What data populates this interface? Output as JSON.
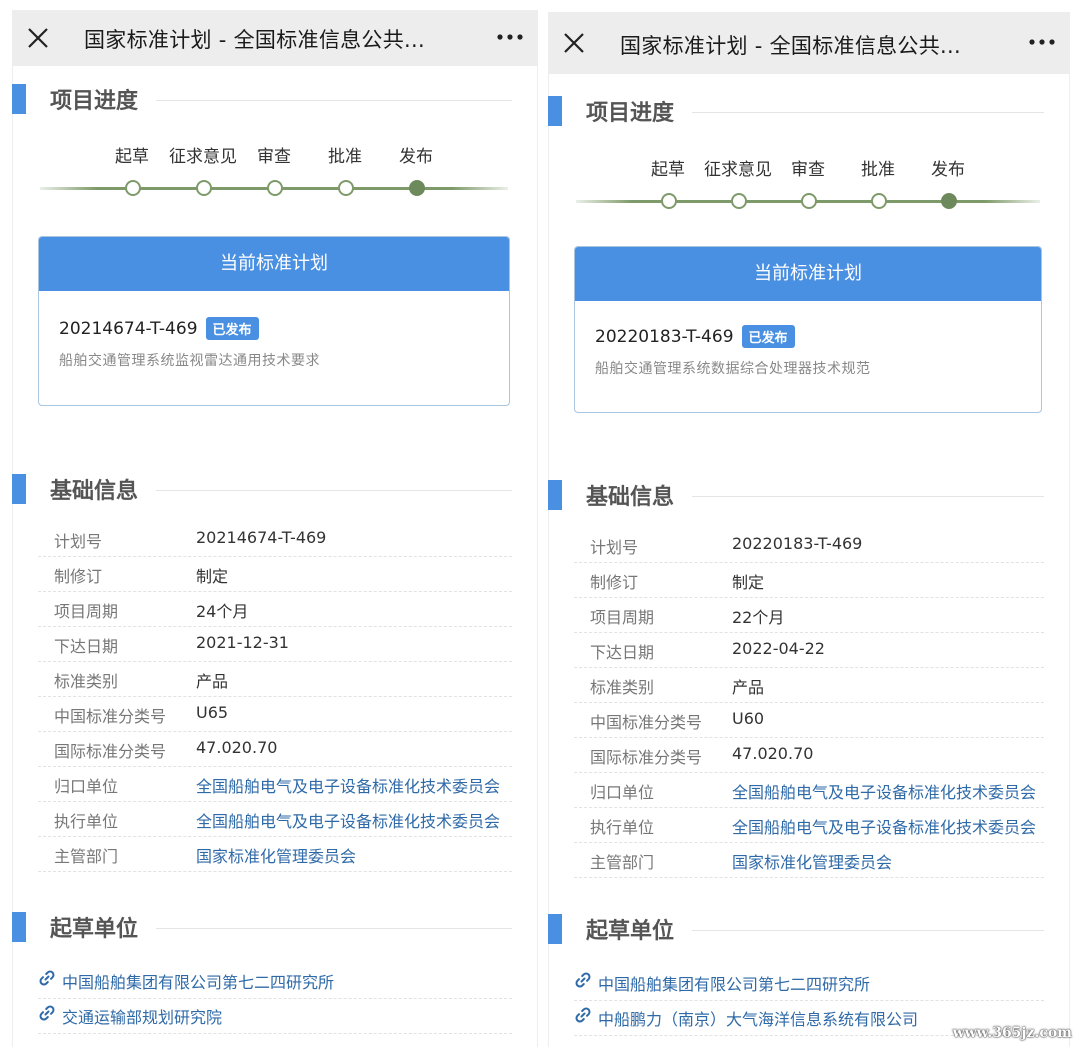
{
  "left": {
    "title": "国家标准计划 - 全国标准信息公共...",
    "sections": {
      "progress": "项目进度",
      "basic": "基础信息",
      "drafters": "起草单位"
    },
    "steps": [
      "起草",
      "征求意见",
      "审查",
      "批准",
      "发布"
    ],
    "current_step": "发布",
    "card": {
      "header": "当前标准计划",
      "number": "20214674-T-469",
      "status": "已发布",
      "name": "船舶交通管理系统监视雷达通用技术要求"
    },
    "info": [
      {
        "key": "计划号",
        "value": "20214674-T-469"
      },
      {
        "key": "制修订",
        "value": "制定"
      },
      {
        "key": "项目周期",
        "value": "24个月"
      },
      {
        "key": "下达日期",
        "value": "2021-12-31"
      },
      {
        "key": "标准类别",
        "value": "产品"
      },
      {
        "key": "中国标准分类号",
        "value": "U65"
      },
      {
        "key": "国际标准分类号",
        "value": "47.020.70"
      },
      {
        "key": "归口单位",
        "value": "全国船舶电气及电子设备标准化技术委员会"
      },
      {
        "key": "执行单位",
        "value": "全国船舶电气及电子设备标准化技术委员会"
      },
      {
        "key": "主管部门",
        "value": "国家标准化管理委员会"
      }
    ],
    "drafters": [
      "中国船舶集团有限公司第七二四研究所",
      "交通运输部规划研究院"
    ]
  },
  "right": {
    "title": "国家标准计划 - 全国标准信息公共...",
    "sections": {
      "progress": "项目进度",
      "basic": "基础信息",
      "drafters": "起草单位"
    },
    "steps": [
      "起草",
      "征求意见",
      "审查",
      "批准",
      "发布"
    ],
    "current_step": "发布",
    "card": {
      "header": "当前标准计划",
      "number": "20220183-T-469",
      "status": "已发布",
      "name": "船舶交通管理系统数据综合处理器技术规范"
    },
    "info": [
      {
        "key": "计划号",
        "value": "20220183-T-469"
      },
      {
        "key": "制修订",
        "value": "制定"
      },
      {
        "key": "项目周期",
        "value": "22个月"
      },
      {
        "key": "下达日期",
        "value": "2022-04-22"
      },
      {
        "key": "标准类别",
        "value": "产品"
      },
      {
        "key": "中国标准分类号",
        "value": "U60"
      },
      {
        "key": "国际标准分类号",
        "value": "47.020.70"
      },
      {
        "key": "归口单位",
        "value": "全国船舶电气及电子设备标准化技术委员会"
      },
      {
        "key": "执行单位",
        "value": "全国船舶电气及电子设备标准化技术委员会"
      },
      {
        "key": "主管部门",
        "value": "国家标准化管理委员会"
      }
    ],
    "drafters": [
      "中国船舶集团有限公司第七二四研究所",
      "中船鹏力（南京）大气海洋信息系统有限公司"
    ]
  },
  "watermark": "www.365jz.com",
  "colors": {
    "accent": "#4a90e2",
    "progress": "#7e9a6a",
    "link": "#2f6aa8"
  },
  "icons": {
    "close": "close-icon",
    "more": "more-icon",
    "link": "link-icon"
  }
}
